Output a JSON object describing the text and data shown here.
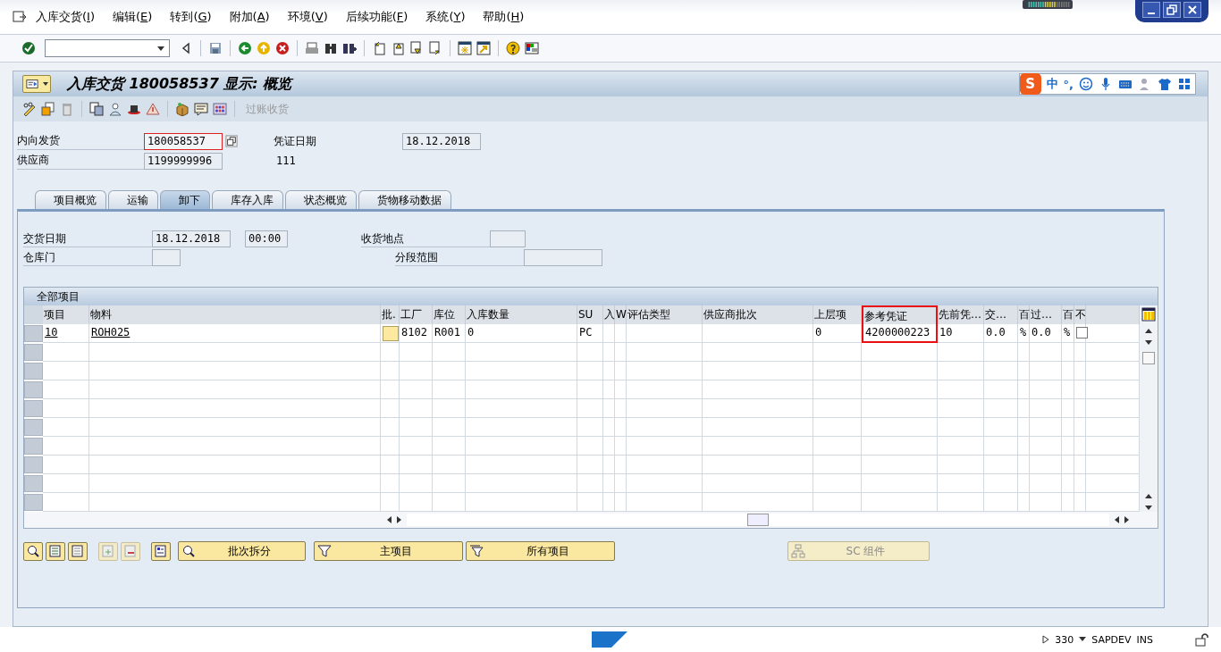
{
  "menu": [
    {
      "before": "入库交货(",
      "key": "I",
      "after": ")"
    },
    {
      "before": "编辑(",
      "key": "E",
      "after": ")"
    },
    {
      "before": "转到(",
      "key": "G",
      "after": ")"
    },
    {
      "before": "附加(",
      "key": "A",
      "after": ")"
    },
    {
      "before": "环境(",
      "key": "V",
      "after": ")"
    },
    {
      "before": "后续功能(",
      "key": "F",
      "after": ")"
    },
    {
      "before": "系统(",
      "key": "Y",
      "after": ")"
    },
    {
      "before": "帮助(",
      "key": "H",
      "after": ")"
    }
  ],
  "title": "入库交货 180058537 显示: 概览",
  "ime": {
    "logo": "S",
    "mode": "中",
    "punctuation": "°,"
  },
  "app_toolbar": {
    "post_button": {
      "label": "过账收货",
      "disabled": true
    }
  },
  "header": {
    "inbound_delivery": {
      "label": "内向发货",
      "value": "180058537",
      "focused": true
    },
    "document_date": {
      "label": "凭证日期",
      "value": "18.12.2018"
    },
    "vendor": {
      "label": "供应商",
      "value": "1199999996",
      "name": "111"
    }
  },
  "tabs": [
    {
      "label": "项目概览",
      "selected": false
    },
    {
      "label": "运输",
      "selected": false
    },
    {
      "label": "卸下",
      "selected": true
    },
    {
      "label": "库存入库",
      "selected": false
    },
    {
      "label": "状态概览",
      "selected": false
    },
    {
      "label": "货物移动数据",
      "selected": false
    }
  ],
  "unloading": {
    "delivery_date": {
      "label": "交货日期",
      "date": "18.12.2018",
      "time": "00:00"
    },
    "warehouse_door": {
      "label": "仓库门"
    },
    "unloading_point": {
      "label": "收货地点"
    },
    "staging_area": {
      "label": "分段范围"
    }
  },
  "table": {
    "title": "全部项目",
    "columns": [
      {
        "label": "项目",
        "kind": "link",
        "highlighted": false
      },
      {
        "label": "物料",
        "kind": "link",
        "highlighted": false
      },
      {
        "label": "批.",
        "kind": "batch",
        "highlighted": false
      },
      {
        "label": "工厂",
        "kind": "text",
        "highlighted": false
      },
      {
        "label": "库位",
        "kind": "text",
        "highlighted": false
      },
      {
        "label": "入库数量",
        "kind": "text",
        "highlighted": false
      },
      {
        "label": "SU",
        "kind": "text",
        "highlighted": false
      },
      {
        "label": "入",
        "kind": "text",
        "highlighted": false
      },
      {
        "label": "W",
        "kind": "text",
        "highlighted": false
      },
      {
        "label": "评估类型",
        "kind": "text",
        "highlighted": false
      },
      {
        "label": "供应商批次",
        "kind": "text",
        "highlighted": false
      },
      {
        "label": "上层项",
        "kind": "text",
        "highlighted": false
      },
      {
        "label": "参考凭证",
        "kind": "text",
        "highlighted": true
      },
      {
        "label": "先前凭…",
        "kind": "text",
        "highlighted": false
      },
      {
        "label": "交…",
        "kind": "text",
        "highlighted": false
      },
      {
        "label": "百",
        "kind": "text",
        "highlighted": false
      },
      {
        "label": "过…",
        "kind": "text",
        "highlighted": false
      },
      {
        "label": "百",
        "kind": "text",
        "highlighted": false
      },
      {
        "label": "不",
        "kind": "checkbox",
        "highlighted": false
      }
    ],
    "rows": [
      {
        "cells": [
          "10",
          "ROH025",
          null,
          "8102",
          "R001",
          "0",
          "PC",
          null,
          null,
          null,
          null,
          "0",
          "4200000223",
          "10",
          "0.0",
          "%",
          "0.0",
          "%",
          false
        ]
      }
    ]
  },
  "buttons": [
    {
      "label": "批次拆分",
      "disabled": false
    },
    {
      "label": "主项目",
      "disabled": false
    },
    {
      "label": "所有项目",
      "disabled": false
    },
    {
      "label": "SC 组件",
      "disabled": true
    }
  ],
  "status_bar": {
    "client": "330",
    "system": "SAPDEV",
    "mode": "INS"
  }
}
